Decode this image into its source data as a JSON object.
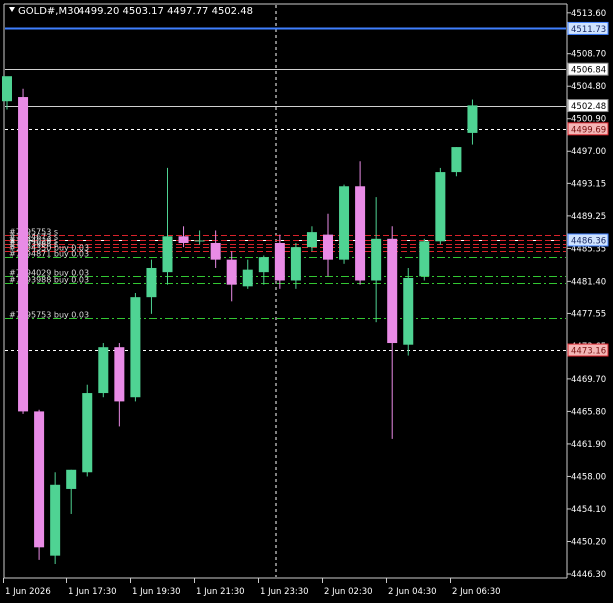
{
  "header": {
    "symbol": "GOLD#,M30",
    "ohlc": "4499.20 4503.17 4497.77 4502.48"
  },
  "colors": {
    "background": "#000000",
    "bull": "#4fd393",
    "bear": "#e98be6",
    "grid": "#cccccc",
    "axis": "#cccccc",
    "text": "#ffffff",
    "line_blue": "#3f7fff",
    "order_red": "#d9232b",
    "order_green": "#33c733",
    "marker_price_red": "#f4b6b6",
    "marker_price_blue": "#cfe3ff"
  },
  "price_axis": {
    "min": 4446.3,
    "max": 4513.7,
    "ticks": [
      "4513.60",
      "4508.70",
      "4504.80",
      "4500.90",
      "4497.00",
      "4493.15",
      "4489.25",
      "4485.35",
      "4481.40",
      "4477.55",
      "4473.65",
      "4469.70",
      "4465.80",
      "4461.90",
      "4458.00",
      "4454.10",
      "4450.20",
      "4446.30"
    ]
  },
  "price_labels": [
    {
      "value": 4511.73,
      "text": "4511.73",
      "style": "blue"
    },
    {
      "value": 4506.84,
      "text": "4506.84",
      "style": "white"
    },
    {
      "value": 4502.48,
      "text": "4502.48",
      "style": "white"
    },
    {
      "value": 4499.69,
      "text": "4499.69",
      "style": "red"
    },
    {
      "value": 4486.36,
      "text": "4486.36",
      "style": "blue"
    },
    {
      "value": 4473.16,
      "text": "4473.16",
      "style": "red"
    }
  ],
  "time_axis": {
    "labels": [
      "1 Jun 2026",
      "1 Jun 17:30",
      "1 Jun 19:30",
      "1 Jun 21:30",
      "1 Jun 23:30",
      "2 Jun 02:30",
      "2 Jun 04:30",
      "2 Jun 06:30"
    ]
  },
  "orders": [
    {
      "price": 4486.9,
      "type": "red",
      "label": "#7195753 s"
    },
    {
      "price": 4486.3,
      "type": "red",
      "label": "#7194673 s"
    },
    {
      "price": 4485.9,
      "type": "red",
      "label": "#7194029 s"
    },
    {
      "price": 4485.5,
      "type": "red",
      "label": "#7193988 s"
    },
    {
      "price": 4485.0,
      "type": "red",
      "label": "#7194350 buy 0.03"
    },
    {
      "price": 4484.3,
      "type": "green",
      "label": "#7194871 buy 0.03"
    },
    {
      "price": 4482.0,
      "type": "green",
      "label": "#7194029 buy 0.03"
    },
    {
      "price": 4481.2,
      "type": "green",
      "label": "#7193988 buy 0.03"
    },
    {
      "price": 4477.0,
      "type": "green",
      "label": "#7195753 buy 0.03"
    }
  ],
  "hlines": [
    {
      "price": 4511.73,
      "style": "blue"
    },
    {
      "price": 4506.84,
      "style": "white"
    },
    {
      "price": 4502.48,
      "style": "white"
    },
    {
      "price": 4499.69,
      "style": "dotted"
    },
    {
      "price": 4486.36,
      "style": "dotted"
    },
    {
      "price": 4473.16,
      "style": "dotted"
    }
  ],
  "chart_data": {
    "type": "candlestick",
    "candles": [
      {
        "o": 4503.0,
        "h": 4504.8,
        "l": 4502.0,
        "c": 4506.0
      },
      {
        "o": 4503.5,
        "h": 4504.5,
        "l": 4465.5,
        "c": 4465.8
      },
      {
        "o": 4465.8,
        "h": 4466.0,
        "l": 4448.0,
        "c": 4449.5
      },
      {
        "o": 4448.5,
        "h": 4458.5,
        "l": 4447.5,
        "c": 4457.0
      },
      {
        "o": 4456.5,
        "h": 4458.8,
        "l": 4453.5,
        "c": 4458.8
      },
      {
        "o": 4458.5,
        "h": 4469.0,
        "l": 4458.0,
        "c": 4468.0
      },
      {
        "o": 4468.0,
        "h": 4474.0,
        "l": 4467.5,
        "c": 4473.5
      },
      {
        "o": 4473.5,
        "h": 4474.0,
        "l": 4464.0,
        "c": 4467.0
      },
      {
        "o": 4467.5,
        "h": 4480.0,
        "l": 4467.0,
        "c": 4479.5
      },
      {
        "o": 4479.5,
        "h": 4484.0,
        "l": 4477.5,
        "c": 4483.0
      },
      {
        "o": 4482.5,
        "h": 4495.0,
        "l": 4481.0,
        "c": 4486.8
      },
      {
        "o": 4486.8,
        "h": 4488.0,
        "l": 4485.5,
        "c": 4486.0
      },
      {
        "o": 4486.2,
        "h": 4487.5,
        "l": 4485.8,
        "c": 4486.3
      },
      {
        "o": 4486.0,
        "h": 4487.5,
        "l": 4483.0,
        "c": 4484.0
      },
      {
        "o": 4484.0,
        "h": 4485.0,
        "l": 4479.0,
        "c": 4481.0
      },
      {
        "o": 4480.8,
        "h": 4484.0,
        "l": 4480.5,
        "c": 4482.8
      },
      {
        "o": 4482.5,
        "h": 4484.5,
        "l": 4481.0,
        "c": 4484.3
      },
      {
        "o": 4486.0,
        "h": 4487.0,
        "l": 4480.5,
        "c": 4481.5
      },
      {
        "o": 4481.5,
        "h": 4486.0,
        "l": 4480.5,
        "c": 4485.5
      },
      {
        "o": 4485.5,
        "h": 4488.0,
        "l": 4485.0,
        "c": 4487.3
      },
      {
        "o": 4487.0,
        "h": 4489.5,
        "l": 4482.0,
        "c": 4484.0
      },
      {
        "o": 4484.0,
        "h": 4493.0,
        "l": 4483.5,
        "c": 4492.8
      },
      {
        "o": 4492.8,
        "h": 4495.8,
        "l": 4481.0,
        "c": 4481.5
      },
      {
        "o": 4481.5,
        "h": 4491.5,
        "l": 4476.5,
        "c": 4486.5
      },
      {
        "o": 4486.5,
        "h": 4488.0,
        "l": 4462.5,
        "c": 4474.0
      },
      {
        "o": 4473.8,
        "h": 4483.0,
        "l": 4472.5,
        "c": 4481.8
      },
      {
        "o": 4482.0,
        "h": 4486.5,
        "l": 4481.5,
        "c": 4486.2
      },
      {
        "o": 4486.2,
        "h": 4495.0,
        "l": 4485.8,
        "c": 4494.5
      },
      {
        "o": 4494.5,
        "h": 4497.5,
        "l": 4494.0,
        "c": 4497.5
      },
      {
        "o": 4499.2,
        "h": 4503.2,
        "l": 4497.8,
        "c": 4502.5
      }
    ]
  }
}
